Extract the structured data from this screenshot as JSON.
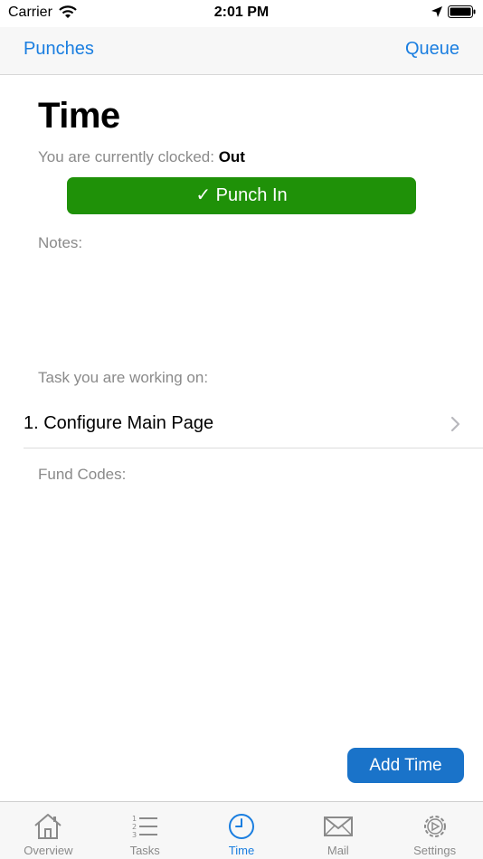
{
  "status": {
    "carrier": "Carrier",
    "time": "2:01 PM"
  },
  "nav": {
    "left": "Punches",
    "right": "Queue"
  },
  "page": {
    "title": "Time",
    "clocked_prefix": "You are currently clocked: ",
    "clocked_state": "Out",
    "punch_button": "✓ Punch In",
    "notes_label": "Notes:",
    "task_label": "Task you are working on:",
    "task_value": "1. Configure Main Page",
    "fund_label": "Fund Codes:",
    "add_time_button": "Add Time"
  },
  "tabs": [
    {
      "label": "Overview",
      "icon": "house-icon",
      "active": false
    },
    {
      "label": "Tasks",
      "icon": "numbered-list-icon",
      "active": false
    },
    {
      "label": "Time",
      "icon": "clock-icon",
      "active": true
    },
    {
      "label": "Mail",
      "icon": "envelope-icon",
      "active": false
    },
    {
      "label": "Settings",
      "icon": "gear-icon",
      "active": false
    }
  ],
  "colors": {
    "accent": "#1a7ee0",
    "punch_green": "#1f9108",
    "add_time_blue": "#1a73c9",
    "muted_text": "#8a8a8a"
  }
}
